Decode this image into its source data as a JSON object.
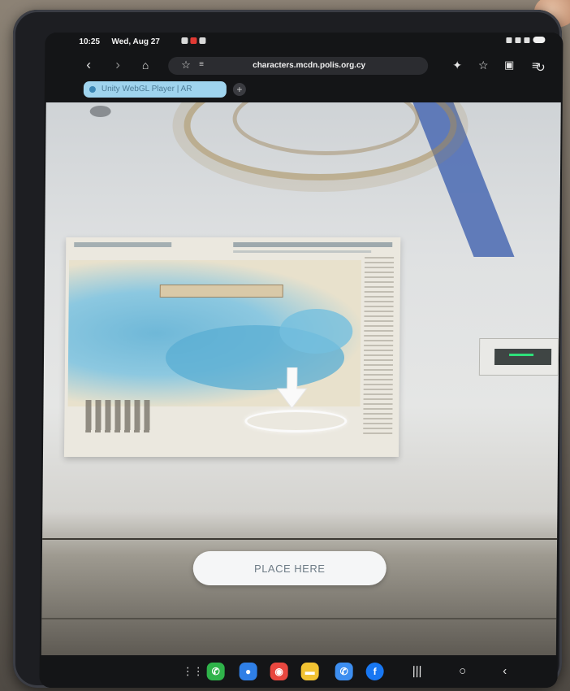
{
  "status_bar": {
    "time": "10:25",
    "date": "Wed, Aug 27"
  },
  "browser": {
    "url": "characters.mcdn.polis.org.cy",
    "tab_label": "Unity WebGL Player | AR",
    "tab_add_label": "+",
    "icons": {
      "back": "back-icon",
      "forward": "forward-icon",
      "home": "home-icon",
      "bookmark": "star-icon",
      "reload": "reload-icon",
      "extensions": "extension-icon",
      "favorites": "star-icon",
      "tabs": "tabs-icon",
      "menu": "menu-icon"
    }
  },
  "ar_view": {
    "place_button_label": "PLACE HERE",
    "indicator_color": "#ffffff",
    "wall_beam_color": "#5270b5"
  },
  "dock": {
    "apps": [
      {
        "name": "phone-app-icon",
        "color": "#2fb34a",
        "glyph": "✆"
      },
      {
        "name": "messages-app-icon",
        "color": "#2f7fe6",
        "glyph": "●"
      },
      {
        "name": "camera-app-icon",
        "color": "#e8473f",
        "glyph": "◉"
      },
      {
        "name": "notes-app-icon",
        "color": "#f1c232",
        "glyph": "▬"
      },
      {
        "name": "phone2-app-icon",
        "color": "#3d8ef0",
        "glyph": "✆"
      },
      {
        "name": "facebook-app-icon",
        "color": "#1877f2",
        "glyph": "f"
      }
    ],
    "nav": {
      "recents": "recents-icon",
      "home": "home-nav-icon",
      "back": "back-nav-icon"
    }
  }
}
